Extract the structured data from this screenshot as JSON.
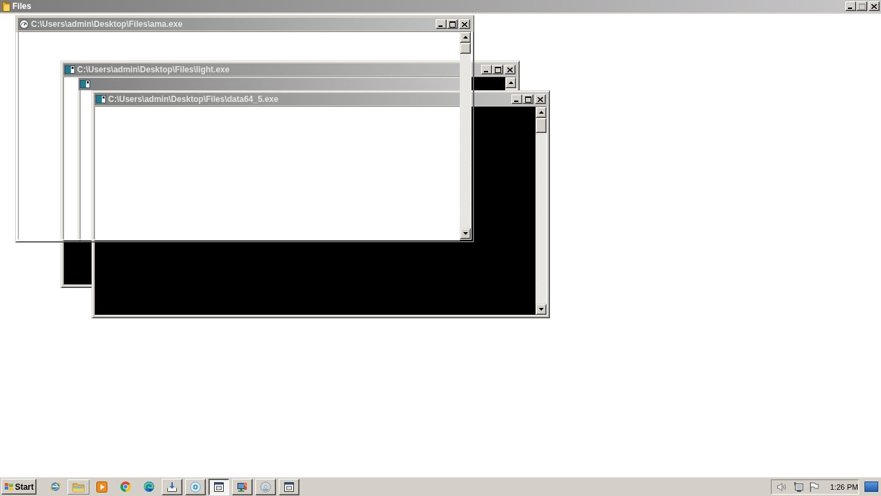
{
  "main_window": {
    "title": "Files",
    "buttons": [
      {
        "kind": "minimize",
        "disabled": false
      },
      {
        "kind": "maximize",
        "disabled": true
      },
      {
        "kind": "close",
        "disabled": false
      }
    ]
  },
  "windows": [
    {
      "kind": "gui",
      "title": "C:\\Users\\admin\\Desktop\\Files\\ama.exe",
      "buttons": [
        {
          "kind": "minimize",
          "disabled": false
        },
        {
          "kind": "maximize",
          "disabled": false
        },
        {
          "kind": "close",
          "disabled": false
        }
      ]
    },
    {
      "kind": "console",
      "title": "C:\\Users\\admin\\Desktop\\Files\\light.exe",
      "child_window": {
        "kind": "console"
      },
      "buttons": [
        {
          "kind": "minimize",
          "disabled": false
        },
        {
          "kind": "maximize",
          "disabled": false
        },
        {
          "kind": "close",
          "disabled": false
        }
      ]
    },
    {
      "kind": "console",
      "title": "C:\\Users\\admin\\Desktop\\Files\\data64_5.exe",
      "buttons": [
        {
          "kind": "minimize",
          "disabled": false
        },
        {
          "kind": "maximize",
          "disabled": false
        },
        {
          "kind": "close",
          "disabled": false
        }
      ]
    }
  ],
  "taskbar": {
    "start": "Start",
    "tasks": [
      {
        "selected": false
      },
      {
        "selected": false
      },
      {
        "selected": true
      },
      {
        "selected": false
      },
      {
        "selected": false
      },
      {
        "selected": false
      }
    ],
    "clock": "1:26 PM"
  }
}
